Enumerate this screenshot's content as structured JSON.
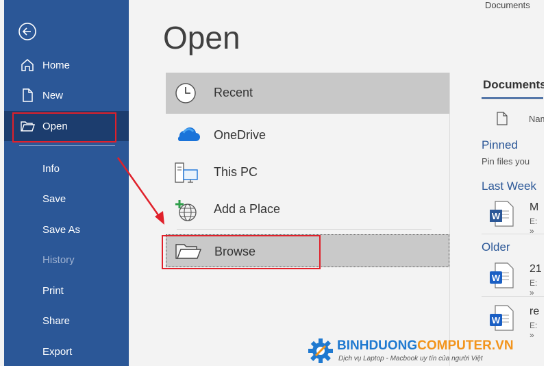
{
  "sidebar": {
    "items": [
      {
        "label": "Home",
        "icon": "home-icon"
      },
      {
        "label": "New",
        "icon": "new-document-icon"
      },
      {
        "label": "Open",
        "icon": "open-folder-icon",
        "active": true
      },
      {
        "label": "Info"
      },
      {
        "label": "Save"
      },
      {
        "label": "Save As"
      },
      {
        "label": "History",
        "disabled": true
      },
      {
        "label": "Print"
      },
      {
        "label": "Share"
      },
      {
        "label": "Export"
      }
    ]
  },
  "main": {
    "title": "Open",
    "locations": [
      {
        "label": "Recent",
        "icon": "clock-icon",
        "selected": true
      },
      {
        "label": "OneDrive",
        "icon": "onedrive-cloud-icon"
      },
      {
        "label": "This PC",
        "icon": "this-pc-icon"
      },
      {
        "label": "Add a Place",
        "icon": "add-place-globe-icon"
      },
      {
        "label": "Browse",
        "icon": "browse-folder-icon"
      }
    ]
  },
  "right_panel": {
    "top_text": "Documents",
    "heading": "Documents",
    "name_column": "Name",
    "pinned_title": "Pinned",
    "pinned_sub": "Pin files you",
    "last_week_title": "Last Week",
    "older_title": "Older",
    "files": [
      {
        "name": "M",
        "path": "E: »",
        "icon": "word-doc-icon"
      },
      {
        "name": "21",
        "path": "E: »",
        "icon": "word-doc-icon"
      },
      {
        "name": "re",
        "path": "E: »",
        "icon": "word-doc-icon"
      }
    ]
  },
  "watermark": {
    "brand_part1": "BINHDUONG",
    "brand_part2": "COMPUTER.VN",
    "tagline": "Dịch vụ Laptop - Macbook uy tín của người Việt"
  },
  "colors": {
    "sidebar": "#2b5797",
    "sidebar_active": "#1c3d6e",
    "highlight_box": "#e0202a",
    "selected_row": "#c8c8c8",
    "brand_blue": "#1f79d0",
    "brand_orange": "#f2941c"
  }
}
